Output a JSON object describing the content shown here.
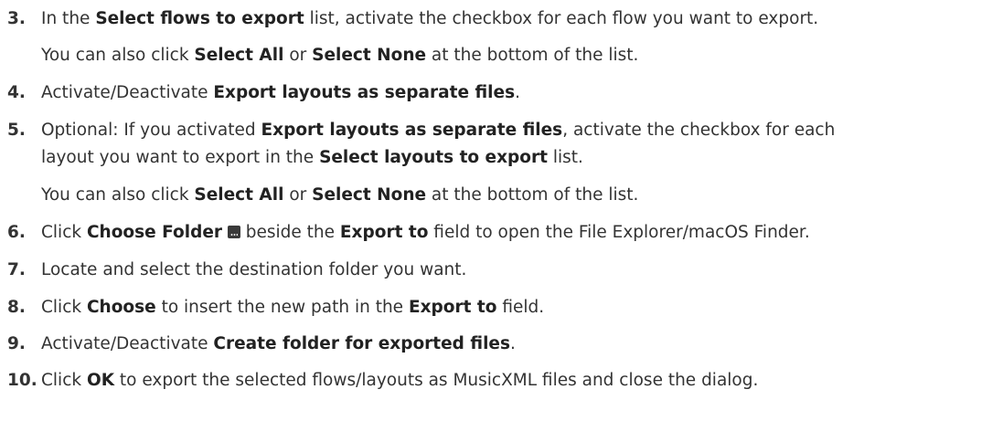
{
  "steps": [
    {
      "number": "3.",
      "lines": [
        [
          "In the ",
          {
            "b": "Select flows to export"
          },
          " list, activate the checkbox for each flow you want to export."
        ],
        [
          "You can also click ",
          {
            "b": "Select All"
          },
          " or ",
          {
            "b": "Select None"
          },
          " at the bottom of the list."
        ]
      ]
    },
    {
      "number": "4.",
      "lines": [
        [
          "Activate/Deactivate ",
          {
            "b": "Export layouts as separate files"
          },
          "."
        ]
      ]
    },
    {
      "number": "5.",
      "lines": [
        [
          "Optional: If you activated ",
          {
            "b": "Export layouts as separate files"
          },
          ", activate the checkbox for each"
        ],
        [
          "layout you want to export in the ",
          {
            "b": "Select layouts to export"
          },
          " list."
        ],
        [
          "You can also click ",
          {
            "b": "Select All"
          },
          " or ",
          {
            "b": "Select None"
          },
          " at the bottom of the list."
        ]
      ]
    },
    {
      "number": "6.",
      "lines": [
        [
          "Click ",
          {
            "b": "Choose Folder"
          },
          " ",
          {
            "icon": "choose-folder-icon"
          },
          " beside the ",
          {
            "b": "Export to"
          },
          " field to open the File Explorer/macOS Finder."
        ]
      ]
    },
    {
      "number": "7.",
      "lines": [
        [
          "Locate and select the destination folder you want."
        ]
      ]
    },
    {
      "number": "8.",
      "lines": [
        [
          "Click ",
          {
            "b": "Choose"
          },
          " to insert the new path in the ",
          {
            "b": "Export to"
          },
          " field."
        ]
      ]
    },
    {
      "number": "9.",
      "lines": [
        [
          "Activate/Deactivate ",
          {
            "b": "Create folder for exported files"
          },
          "."
        ]
      ]
    },
    {
      "number": "10.",
      "lines": [
        [
          "Click ",
          {
            "b": "OK"
          },
          " to export the selected flows/layouts as MusicXML files and close the dialog."
        ]
      ]
    }
  ]
}
